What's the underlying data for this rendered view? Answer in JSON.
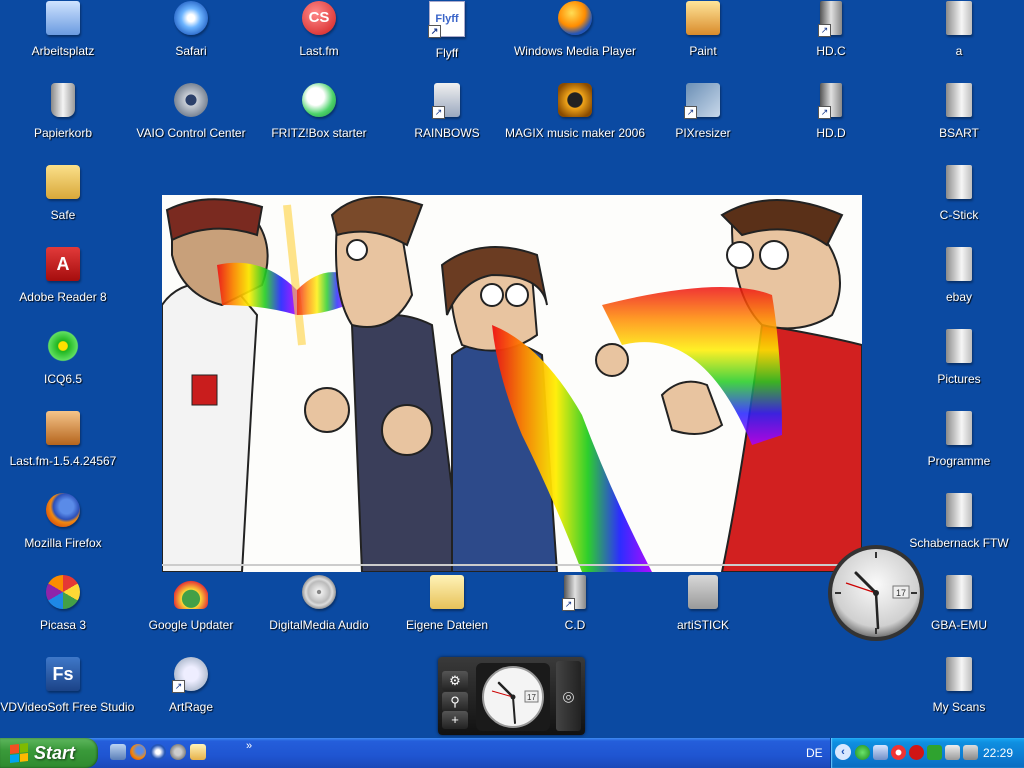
{
  "desktop": {
    "icons": [
      {
        "id": "arbeitsplatz",
        "label": "Arbeitsplatz",
        "icon": "computer-icon",
        "shortcut": false
      },
      {
        "id": "safari",
        "label": "Safari",
        "icon": "safari-icon",
        "shortcut": false
      },
      {
        "id": "lastfm",
        "label": "Last.fm",
        "icon": "lastfm-icon",
        "shortcut": false
      },
      {
        "id": "flyff",
        "label": "Flyff",
        "icon": "flyff-icon",
        "shortcut": true
      },
      {
        "id": "wmp",
        "label": "Windows Media Player",
        "icon": "media-player-icon",
        "shortcut": false
      },
      {
        "id": "paint",
        "label": "Paint",
        "icon": "paint-icon",
        "shortcut": false
      },
      {
        "id": "hdc",
        "label": "HD.C",
        "icon": "drive-icon",
        "shortcut": true
      },
      {
        "id": "a",
        "label": "a",
        "icon": "folder-icon",
        "shortcut": false
      },
      {
        "id": "papierkorb",
        "label": "Papierkorb",
        "icon": "recycle-bin-icon",
        "shortcut": false
      },
      {
        "id": "vaio",
        "label": "VAIO Control Center",
        "icon": "gear-icon",
        "shortcut": false
      },
      {
        "id": "fritz",
        "label": "FRITZ!Box starter",
        "icon": "network-icon",
        "shortcut": false
      },
      {
        "id": "rainbows",
        "label": "RAINBOWS",
        "icon": "media-file-icon",
        "shortcut": true
      },
      {
        "id": "magix",
        "label": "MAGIX music maker 2006",
        "icon": "speaker-icon",
        "shortcut": false
      },
      {
        "id": "pixresizer",
        "label": "PIXresizer",
        "icon": "resize-icon",
        "shortcut": true
      },
      {
        "id": "hdd",
        "label": "HD.D",
        "icon": "drive-icon",
        "shortcut": true
      },
      {
        "id": "bsart",
        "label": "BSART",
        "icon": "folder-icon",
        "shortcut": false
      },
      {
        "id": "safe",
        "label": "Safe",
        "icon": "safe-folder-icon",
        "shortcut": false
      },
      {
        "id": "cstick",
        "label": "C-Stick",
        "icon": "folder-icon",
        "shortcut": false
      },
      {
        "id": "adobe",
        "label": "Adobe Reader 8",
        "icon": "pdf-icon",
        "shortcut": false
      },
      {
        "id": "ebay",
        "label": "ebay",
        "icon": "folder-icon",
        "shortcut": false
      },
      {
        "id": "icq",
        "label": "ICQ6.5",
        "icon": "icq-flower-icon",
        "shortcut": false
      },
      {
        "id": "pictures",
        "label": "Pictures",
        "icon": "folder-icon",
        "shortcut": false
      },
      {
        "id": "lastfminst",
        "label": "Last.fm-1.5.4.24567",
        "icon": "installer-icon",
        "shortcut": false
      },
      {
        "id": "programme",
        "label": "Programme",
        "icon": "folder-icon",
        "shortcut": false
      },
      {
        "id": "firefox",
        "label": "Mozilla Firefox",
        "icon": "firefox-icon",
        "shortcut": false
      },
      {
        "id": "schabernack",
        "label": "Schabernack FTW",
        "icon": "folder-icon",
        "shortcut": false
      },
      {
        "id": "picasa",
        "label": "Picasa 3",
        "icon": "picasa-icon",
        "shortcut": false
      },
      {
        "id": "gupdater",
        "label": "Google Updater",
        "icon": "google-updater-icon",
        "shortcut": false
      },
      {
        "id": "dmaudio",
        "label": "DigitalMedia Audio",
        "icon": "cd-icon",
        "shortcut": false
      },
      {
        "id": "eigene",
        "label": "Eigene Dateien",
        "icon": "documents-folder-icon",
        "shortcut": false
      },
      {
        "id": "cd",
        "label": "C.D",
        "icon": "drive-icon",
        "shortcut": true
      },
      {
        "id": "artstick",
        "label": "artiSTICK",
        "icon": "usb-help-icon",
        "shortcut": false
      },
      {
        "id": "gbaemu",
        "label": "GBA-EMU",
        "icon": "folder-icon",
        "shortcut": false
      },
      {
        "id": "dvdvideosoft",
        "label": "DVDVideoSoft Free Studio",
        "icon": "fs-icon",
        "shortcut": false
      },
      {
        "id": "artrage",
        "label": "ArtRage",
        "icon": "artrage-icon",
        "shortcut": true
      },
      {
        "id": "myscans",
        "label": "My Scans",
        "icon": "folder-icon",
        "shortcut": false
      }
    ]
  },
  "gadgets": {
    "clock_date": "17",
    "sidebar_date": "17",
    "sidebar_buttons": [
      "gear-icon",
      "search-icon",
      "plus-icon"
    ]
  },
  "taskbar": {
    "start_label": "Start",
    "quick_launch": [
      "show-desktop-icon",
      "firefox-icon",
      "media-player-icon",
      "settings-icon",
      "paint-icon"
    ],
    "chevron": "»",
    "language": "DE",
    "time": "22:29"
  },
  "colors": {
    "desktop": "#0b4aa2",
    "taskbar": "#245edb",
    "start": "#3a9a3a",
    "tray": "#0f8fe0"
  }
}
